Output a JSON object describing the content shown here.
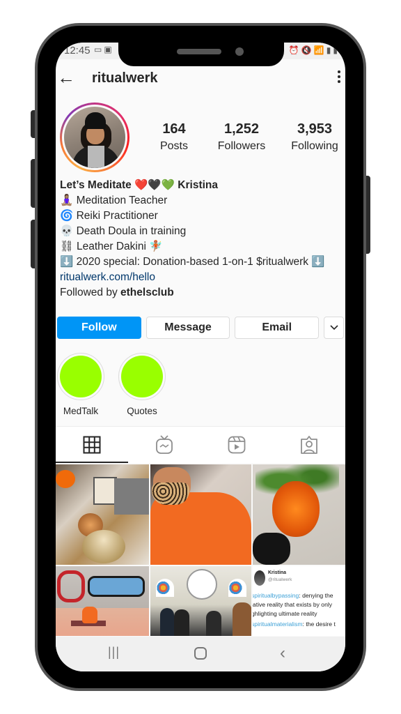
{
  "status_bar": {
    "time": "12:45",
    "left_icons": [
      "cast-icon",
      "image-icon"
    ],
    "right_icons": [
      "alarm-icon",
      "mute-icon",
      "wifi-icon",
      "signal-icon",
      "battery-icon"
    ]
  },
  "header": {
    "back_icon": "←",
    "username": "ritualwerk",
    "more_icon": "more-vertical-icon"
  },
  "profile": {
    "stats": [
      {
        "value": "164",
        "label": "Posts"
      },
      {
        "value": "1,252",
        "label": "Followers"
      },
      {
        "value": "3,953",
        "label": "Following"
      }
    ],
    "bio": {
      "name": "Let’s Meditate ❤️🖤💚 Kristina",
      "lines": [
        "🧘🏽‍♀️ Meditation Teacher",
        "🌀 Reiki Practitioner",
        "💀 Death Doula in training",
        "⛓ Leather Dakini 🧚🏽",
        "⬇️ 2020 special: Donation-based 1-on-1 $ritualwerk ⬇️"
      ],
      "link": "ritualwerk.com/hello",
      "followed_by_prefix": "Followed by ",
      "followed_by_user": "ethelsclub"
    }
  },
  "actions": {
    "follow": "Follow",
    "message": "Message",
    "email": "Email",
    "more": "⌄"
  },
  "highlights": [
    {
      "label": "MedTalk",
      "color": "#99ff00"
    },
    {
      "label": "Quotes",
      "color": "#99ff00"
    }
  ],
  "tabs": [
    {
      "name": "posts-grid",
      "icon": "grid-icon",
      "active": true
    },
    {
      "name": "igtv",
      "icon": "igtv-icon",
      "active": false
    },
    {
      "name": "reels",
      "icon": "reels-icon",
      "active": false
    },
    {
      "name": "tagged",
      "icon": "tagged-user-icon",
      "active": false
    }
  ],
  "posts": [
    {
      "description": "altar with singing bowls and marigold"
    },
    {
      "description": "selfie in orange hoodie with leopard mask"
    },
    {
      "description": "orange marigold flower"
    },
    {
      "description": "meditation class in front of graffiti wall"
    },
    {
      "description": "group meditation in hall with rose window"
    },
    {
      "description": "tweet screenshot",
      "tweet": {
        "name": "Kristina",
        "handle": "@ritualwerk",
        "lines": [
          {
            "tag": "spiritualbypassing",
            "text": ": denying the"
          },
          {
            "tag": "",
            "text": "lative reality that exists by only"
          },
          {
            "tag": "",
            "text": "ghlighting ultimate reality"
          },
          {
            "tag": "spiritualmaterialism",
            "text": ": the desire t"
          }
        ]
      }
    }
  ],
  "nav_bar": {
    "recents": "|||",
    "back": "‹"
  },
  "colors": {
    "follow_button": "#0095f6",
    "link": "#00376b",
    "highlight": "#99ff00",
    "hashtag": "#3ca0d6"
  }
}
